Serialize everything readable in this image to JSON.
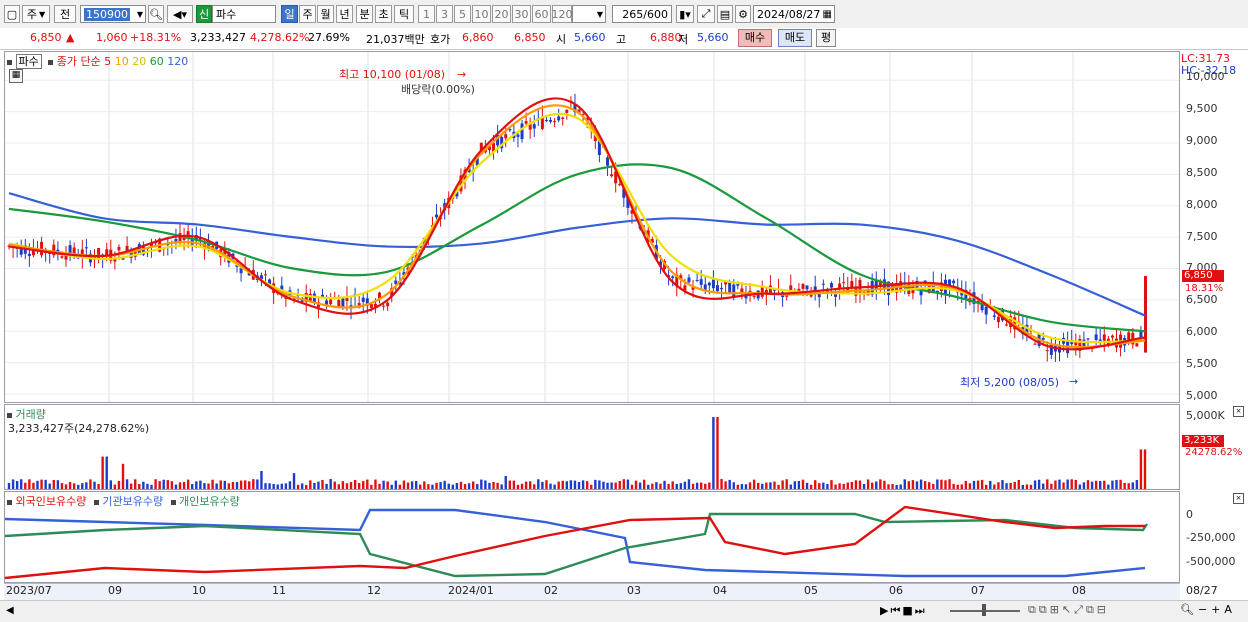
{
  "toolbar": {
    "market_label": "주",
    "prev_label": "전",
    "code_value": "150900",
    "new_badge": "신",
    "stock_name": "파수",
    "periods": [
      "일",
      "주",
      "월",
      "년",
      "분",
      "초",
      "틱"
    ],
    "intervals": [
      "1",
      "3",
      "5",
      "10",
      "20",
      "30",
      "60",
      "120"
    ],
    "count_value": "265",
    "count_total": "/600",
    "date_value": "2024/08/27"
  },
  "quote": {
    "price": "6,850",
    "price_arrow": "▲",
    "change": "1,060",
    "change_pct": "+18.31%",
    "volume": "3,233,427",
    "volume_pct": "4,278.62%",
    "turnover_pct": "27.69%",
    "amount": "21,037백만",
    "ask_label": "호가",
    "ask_price": "6,860",
    "bid_price": "6,850",
    "open_label": "시",
    "open_value": "5,660",
    "high_label": "고",
    "high_value": "6,880",
    "low_label": "저",
    "low_value": "5,660",
    "buy_label": "매수",
    "sell_label": "매도",
    "avg_label": "평"
  },
  "price_panel": {
    "tab_label": "파수",
    "legend_prefix": "종가 단순",
    "ma_legend": [
      {
        "label": "5",
        "color": "#e01010"
      },
      {
        "label": "10",
        "color": "#ff9900"
      },
      {
        "label": "20",
        "color": "#e6d200"
      },
      {
        "label": "60",
        "color": "#1a9a3a"
      },
      {
        "label": "120",
        "color": "#3560d8"
      }
    ],
    "high_note": "최고 10,100 (01/08)",
    "dividend_note": "배당락(0.00%)",
    "low_note": "최저 5,200 (08/05)",
    "lc_label": "LC:31.73",
    "hc_label": "HC:-32.18",
    "last_price_tag": "6,850",
    "last_pct_tag": "18.31%",
    "y_ticks": [
      "10,000",
      "9,500",
      "9,000",
      "8,500",
      "8,000",
      "7,500",
      "7,000",
      "6,500",
      "6,000",
      "5,500",
      "5,000"
    ]
  },
  "volume_panel": {
    "title": "거래량",
    "value_text": "3,233,427주(24,278.62%)",
    "y_tick": "5,000K",
    "last_tag": "3,233K",
    "last_pct_tag": "24278.62%"
  },
  "holdings_panel": {
    "legend": [
      {
        "label": "외국인보유수량",
        "color": "#e01010"
      },
      {
        "label": "기관보유수량",
        "color": "#3560d8"
      },
      {
        "label": "개인보유수량",
        "color": "#2e8b57"
      }
    ],
    "y_ticks": [
      "0",
      "-250,000",
      "-500,000"
    ]
  },
  "x_axis": {
    "labels": [
      "2023/07",
      "09",
      "10",
      "11",
      "12",
      "2024/01",
      "02",
      "03",
      "04",
      "05",
      "06",
      "07",
      "08",
      "08/27"
    ]
  },
  "colors": {
    "up": "#e01010",
    "down": "#1a3cc8",
    "ma5": "#e01010",
    "ma10": "#ff9900",
    "ma20": "#f0e000",
    "ma60": "#1a9a3a",
    "ma120": "#3560d8"
  },
  "chart_data": {
    "type": "line",
    "title": "",
    "x": [
      "2023/07",
      "09",
      "10",
      "11",
      "12",
      "2024/01",
      "02",
      "03",
      "04",
      "05",
      "06",
      "07",
      "08"
    ],
    "series": [
      {
        "name": "5",
        "values": [
          7350,
          7200,
          7500,
          6500,
          6500,
          8900,
          9600,
          6800,
          6600,
          6700,
          6700,
          5750,
          5900
        ]
      },
      {
        "name": "10",
        "values": [
          7380,
          7200,
          7400,
          6550,
          6600,
          8850,
          9500,
          6950,
          6600,
          6650,
          6680,
          5800,
          5850
        ]
      },
      {
        "name": "20",
        "values": [
          7400,
          7150,
          7350,
          6600,
          6800,
          8700,
          9400,
          7200,
          6700,
          6600,
          6650,
          5900,
          5850
        ]
      },
      {
        "name": "60",
        "values": [
          7950,
          7750,
          7450,
          7000,
          6950,
          7700,
          8500,
          8600,
          7800,
          6900,
          6550,
          6150,
          6000
        ]
      },
      {
        "name": "120",
        "values": [
          8200,
          7800,
          7700,
          7500,
          7350,
          7400,
          7650,
          7800,
          7700,
          7700,
          7450,
          6900,
          6250
        ]
      }
    ],
    "ylim": [
      5000,
      10100
    ]
  }
}
